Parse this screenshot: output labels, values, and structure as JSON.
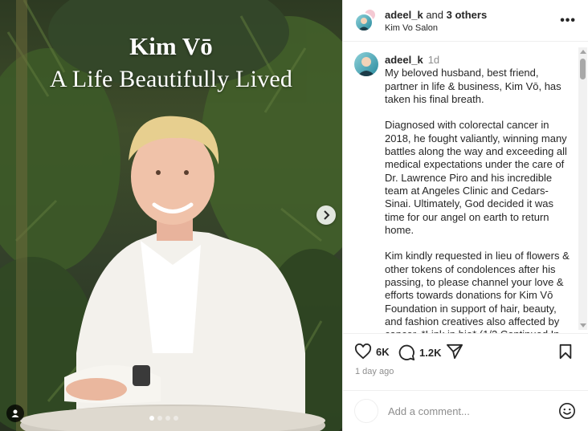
{
  "media": {
    "overlay_title_line1": "Kim Vō",
    "overlay_title_line2": "A Life Beautifully Lived",
    "carousel_dots": 4,
    "active_dot": 0,
    "icons": {
      "next": "chevron-right-icon",
      "tagged": "user-icon"
    }
  },
  "header": {
    "username": "adeel_k",
    "and_text": " and ",
    "others": "3 others",
    "location": "Kim Vo Salon",
    "more_label": "•••"
  },
  "caption": {
    "username": "adeel_k",
    "time": "1d",
    "paragraphs": [
      "My beloved husband, best friend, partner in life & business, Kim Vō, has taken his final breath.",
      "Diagnosed with colorectal cancer in 2018, he fought valiantly, winning many battles along the way and exceeding all medical expectations under the care of Dr. Lawrence Piro and his incredible team at Angeles Clinic and Cedars-Sinai. Ultimately, God decided it was time for our angel on earth to return home.",
      "Kim kindly requested in lieu of flowers & other tokens of condolences after his passing, to please channel your love & efforts towards donations for Kim Vō Foundation in support of hair, beauty, and fashion creatives also affected by cancer. *Link in bio* (1/2 Continued In"
    ]
  },
  "actions": {
    "likes": "6K",
    "comments": "1.2K",
    "timestamp": "1 day ago",
    "icons": {
      "like": "heart-icon",
      "comment": "comment-icon",
      "share": "paper-plane-icon",
      "save": "bookmark-icon"
    }
  },
  "add_comment": {
    "placeholder": "Add a comment...",
    "icon": "emoji-icon"
  },
  "colors": {
    "text": "#262626",
    "muted": "#8e8e8e",
    "border": "#efefef"
  }
}
